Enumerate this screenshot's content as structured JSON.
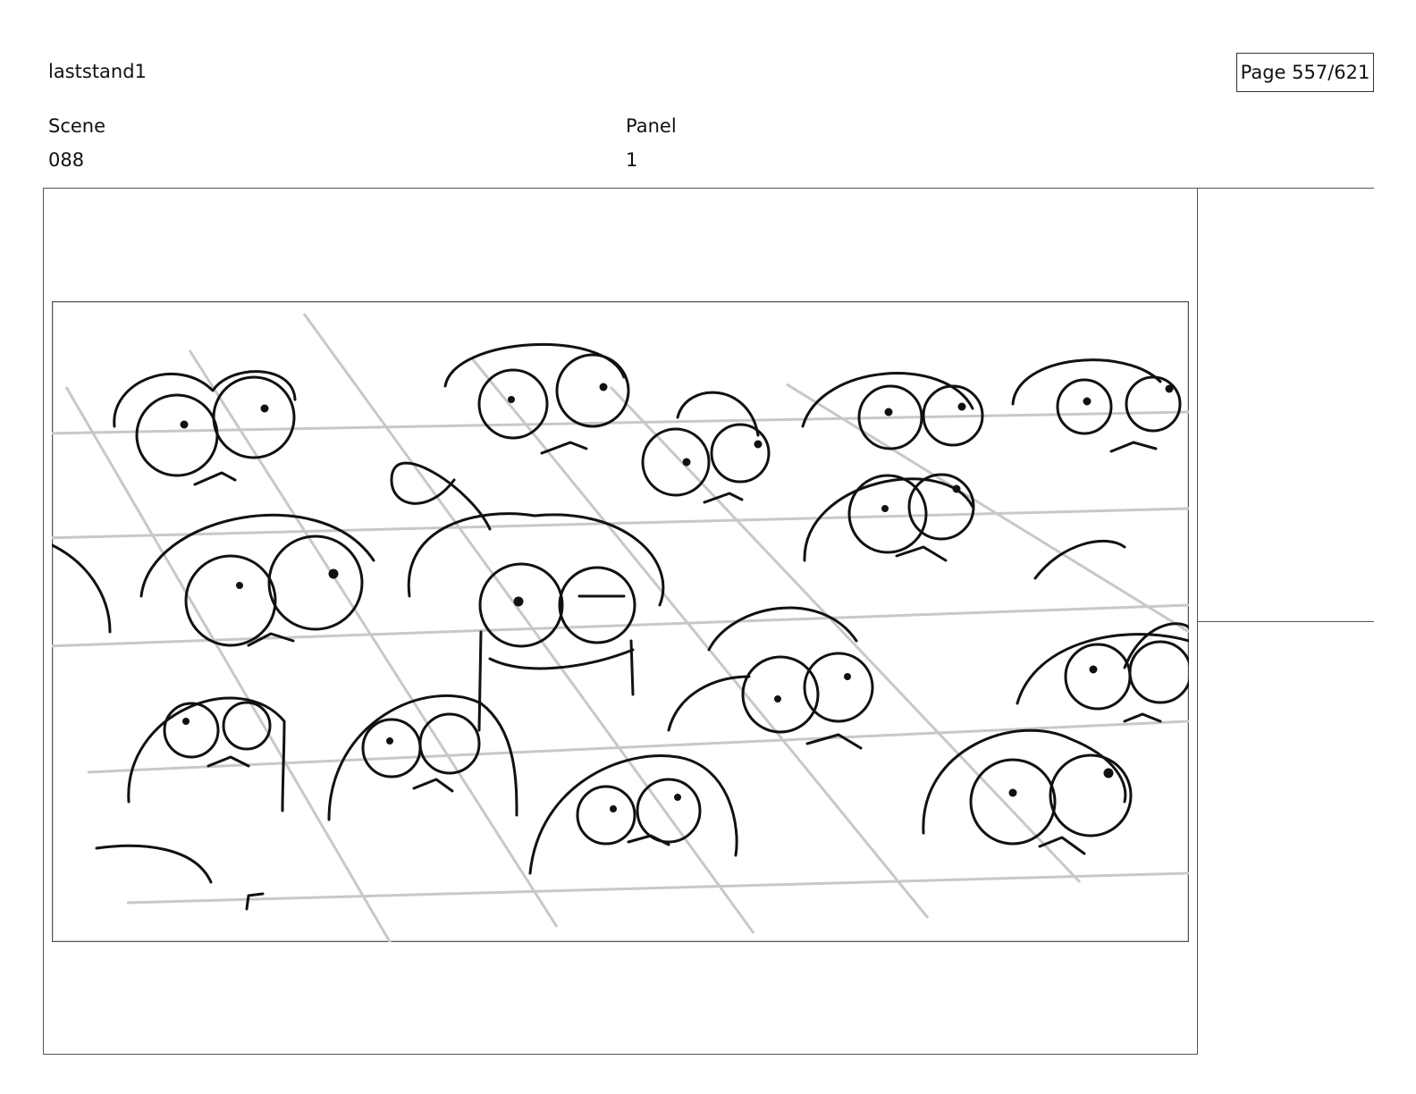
{
  "header": {
    "project_name": "laststand1",
    "page_counter": "Page 557/621"
  },
  "meta": {
    "scene_label": "Scene",
    "scene_value": "088",
    "panel_label": "Panel",
    "panel_value": "1"
  },
  "colors": {
    "ink": "#111111",
    "guide_lines": "#c8c8c8",
    "frame": "#555555"
  }
}
